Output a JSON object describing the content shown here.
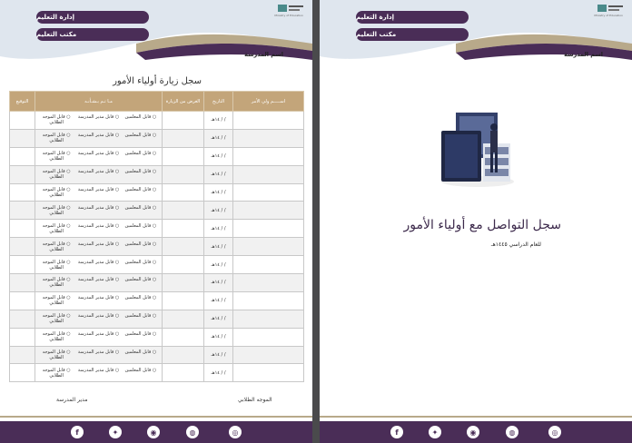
{
  "header": {
    "pill_top": "إدارة التعليم",
    "pill_bottom": "مكتب التعليم",
    "school_label": "اسم المدرسة",
    "ministry_name": "وزارة التعليم",
    "ministry_name_en": "Ministry of Education"
  },
  "left_page": {
    "table_title": "سجل زيارة أولياء الأمور",
    "columns": [
      "اســـــم ولي الأمر",
      "التاريخ",
      "الغرض من الزيارة",
      "مـا تـم بـشـأنـه",
      "التوقيع"
    ],
    "date_placeholder": "/ / ١٤هـ",
    "options": {
      "teachers": "○ قابل المعلمين",
      "principal": "○ قابل مدير المدرسة",
      "counselor": "○ قابل الموجه الطلابي"
    },
    "row_count": 15,
    "signature_supervisor": "الموجه الطلابي",
    "signature_manager": "مدير المدرسة"
  },
  "right_page": {
    "cover_title": "سجل التواصل مع أولياء الأمور",
    "cover_subtitle": "للعام الدراسي ١٤٤٥هـ"
  },
  "footer": {
    "icons": [
      "instagram-icon",
      "website-icon",
      "snapchat-icon",
      "twitter-icon",
      "facebook-icon"
    ],
    "glyphs": [
      "◎",
      "◍",
      "◉",
      "✦",
      "f"
    ]
  },
  "colors": {
    "primary": "#4a2d57",
    "gold": "#b8a98a",
    "table_header": "#c3a57a",
    "light_blue": "#dfe6ee"
  }
}
